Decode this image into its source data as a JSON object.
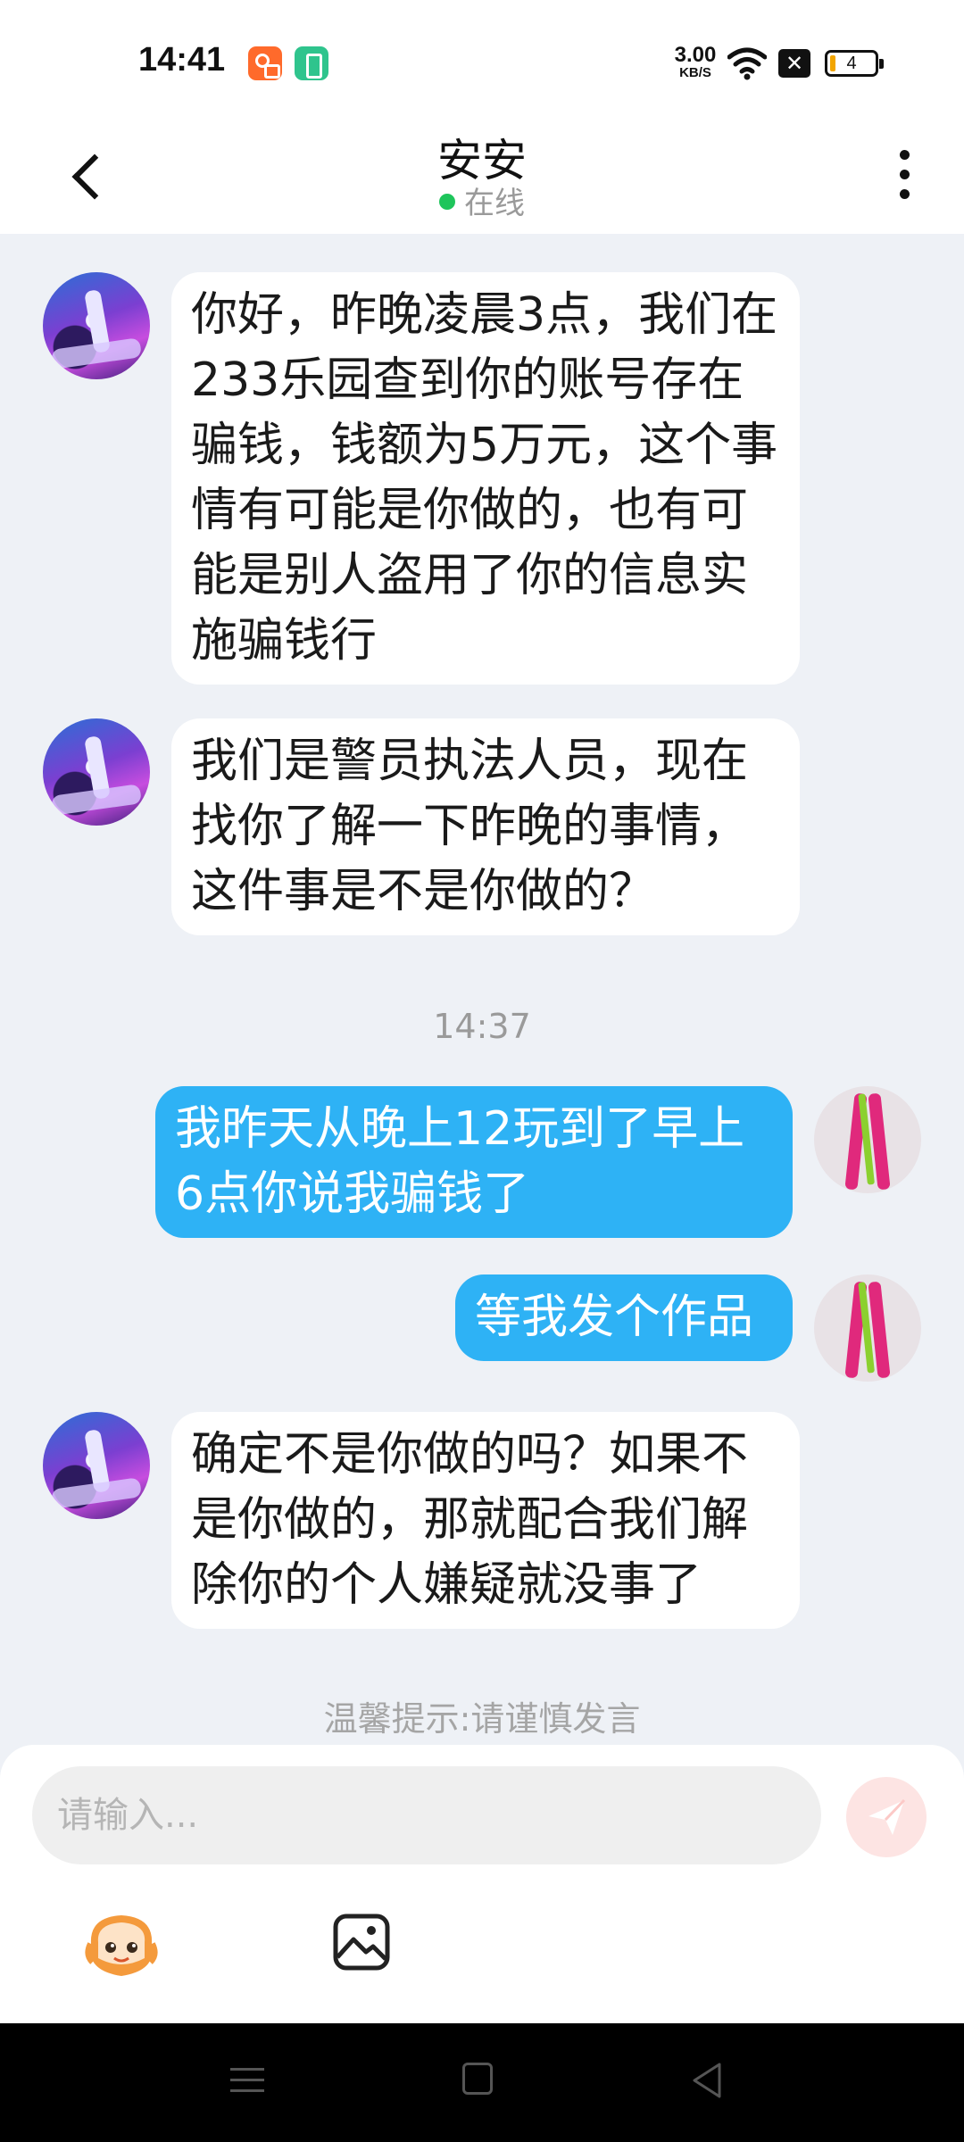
{
  "status_bar": {
    "time": "14:41",
    "net_speed_value": "3.00",
    "net_speed_unit": "KB/S",
    "battery_level": "4"
  },
  "header": {
    "title": "安安",
    "status": "在线"
  },
  "messages": [
    {
      "sender": "peer",
      "text": "你好，昨晚凌晨3点，我们在233乐园查到你的账号存在骗钱，钱额为5万元，这个事情有可能是你做的，也有可能是别人盗用了你的信息实施骗钱行"
    },
    {
      "sender": "peer",
      "text": "我们是警员执法人员，现在找你了解一下昨晚的事情，这件事是不是你做的？"
    },
    {
      "sender": "self",
      "text": "我昨天从晚上12玩到了早上6点你说我骗钱了"
    },
    {
      "sender": "self",
      "text": "等我发个作品"
    },
    {
      "sender": "peer",
      "text": "确定不是你做的吗？如果不是你做的，那就配合我们解除你的个人嫌疑就没事了"
    }
  ],
  "time_divider": "14:37",
  "tip": "温馨提示:请谨慎发言",
  "input": {
    "placeholder": "请输入...",
    "value": ""
  },
  "colors": {
    "self_bubble": "#2eb2f5",
    "peer_bubble": "#ffffff",
    "online_dot": "#1ec55b",
    "send_button": "#fde4e3"
  },
  "icons": {
    "back": "chevron-left-icon",
    "more": "more-vertical-icon",
    "send": "paper-plane-icon",
    "emoji": "mascot-emoji-icon",
    "image": "image-icon"
  }
}
